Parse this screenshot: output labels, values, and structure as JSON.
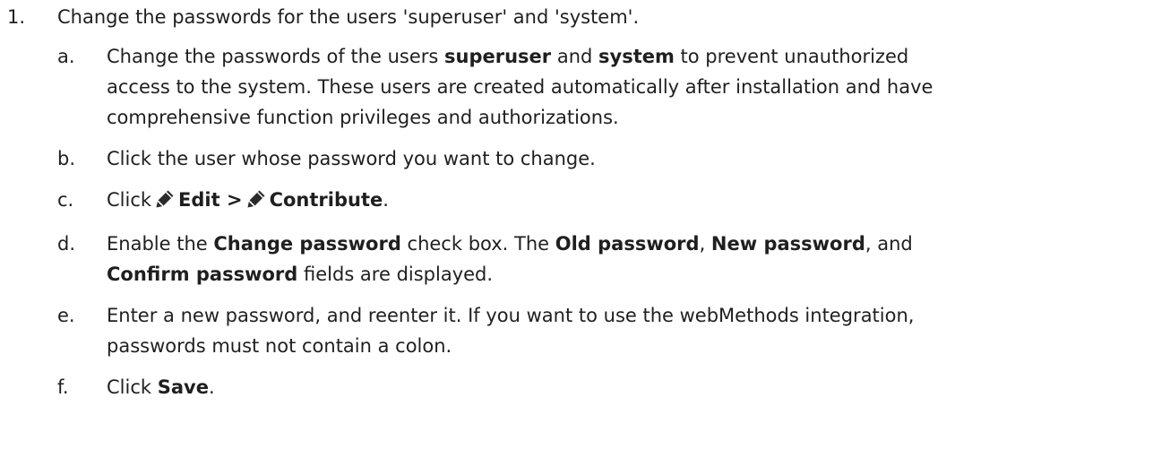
{
  "step": {
    "number": "1.",
    "title": "Change the passwords for the users 'superuser' and 'system'."
  },
  "a": {
    "letter": "a.",
    "t1": "Change the passwords of the users ",
    "b1": "superuser",
    "t2": " and ",
    "b2": "system",
    "t3": " to prevent unauthorized",
    "l2": "access to the system. These users are created automatically after installation and have",
    "l3": "comprehensive function privileges and authorizations."
  },
  "b": {
    "letter": "b.",
    "text": "Click the user whose password you want to change."
  },
  "c": {
    "letter": "c.",
    "t1": "Click",
    "b1": "Edit >",
    "b2": "Contribute",
    "t2": ".",
    "icon": "pencil-icon"
  },
  "d": {
    "letter": "d.",
    "t1": "Enable the ",
    "b1": "Change password",
    "t2": " check box. The ",
    "b2": "Old password",
    "t3": ", ",
    "b3": "New password",
    "t4": ", and",
    "b4": "Confirm password",
    "t5": " fields are displayed."
  },
  "e": {
    "letter": "e.",
    "l1": "Enter a new password, and reenter it. If you want to use the webMethods integration,",
    "l2": "passwords must not contain a colon."
  },
  "f": {
    "letter": "f.",
    "t1": "Click ",
    "b1": "Save",
    "t2": "."
  }
}
